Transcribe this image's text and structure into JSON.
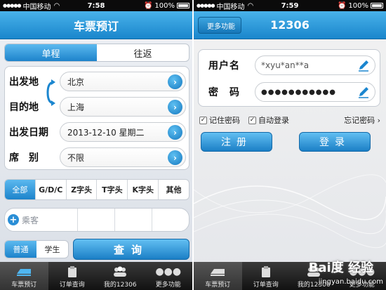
{
  "left": {
    "status": {
      "carrier": "中国移动",
      "time": "7:58",
      "battery": "100%"
    },
    "title": "车票预订",
    "trip_tabs": [
      "单程",
      "往返"
    ],
    "form": {
      "from_label": "出发地",
      "from_value": "北京",
      "to_label": "目的地",
      "to_value": "上海",
      "date_label": "出发日期",
      "date_value": "2013-12-10 星期二",
      "seat_label": "席　别",
      "seat_value": "不限"
    },
    "train_types": [
      "全部",
      "G/D/C",
      "Z字头",
      "T字头",
      "K字头",
      "其他"
    ],
    "passenger_add": "乘客",
    "passenger_types": [
      "普通",
      "学生"
    ],
    "query_button": "查询",
    "tabs": [
      "车票预订",
      "订单查询",
      "我的12306",
      "更多功能"
    ]
  },
  "right": {
    "status": {
      "carrier": "中国移动",
      "time": "7:59",
      "battery": "100%"
    },
    "back_button": "更多功能",
    "title": "12306",
    "username_label": "用户名",
    "username_value": "*xyu*an**a",
    "password_label": "密　码",
    "password_value": "●●●●●●●●●●●",
    "remember_password": "记住密码",
    "auto_login": "自动登录",
    "forgot_password": "忘记密码 ›",
    "register_button": "注册",
    "login_button": "登录",
    "tabs": [
      "车票预订",
      "订单查询",
      "我的12306",
      "更多功能"
    ]
  },
  "watermark": {
    "logo": "Bai度 经验",
    "url": "jingyan.baidu.com"
  },
  "colors": {
    "accent": "#1d83cb",
    "titlebar": "#2a96d8",
    "tabbar": "#1a1a1a"
  }
}
